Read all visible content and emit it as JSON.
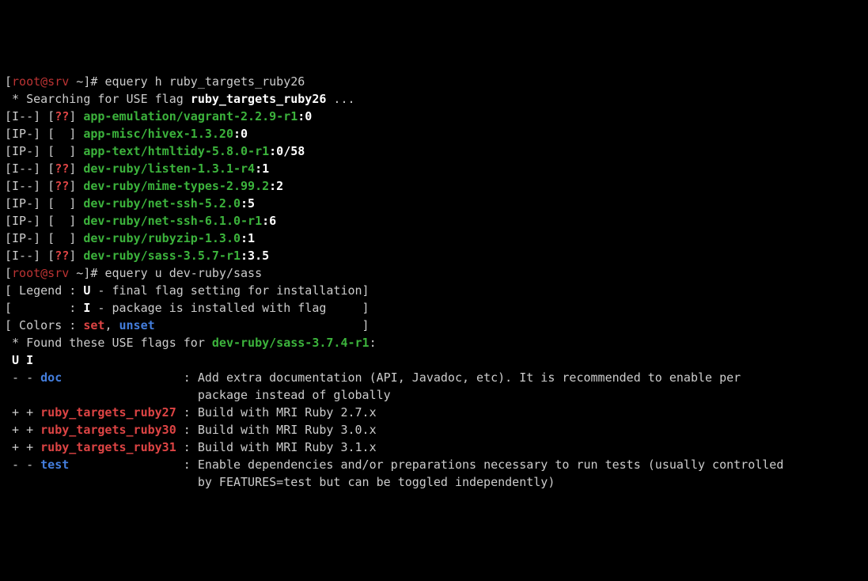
{
  "prompt1_user": "root@srv",
  "prompt1_path": "~",
  "cmd1": "equery h ruby_targets_ruby26",
  "searching_prefix": " * Searching for USE flag ",
  "searching_flag": "ruby_targets_ruby26",
  "searching_suffix": " ...",
  "results": [
    {
      "inst": "I--",
      "mask_open": "[",
      "mask": "??",
      "mask_close": "]",
      "pkg": "app-emulation/vagrant-2.2.9-r1",
      "slot": ":0"
    },
    {
      "inst": "IP-",
      "mask_open": "[",
      "mask": "  ",
      "mask_close": "]",
      "pkg": "app-misc/hivex-1.3.20",
      "slot": ":0"
    },
    {
      "inst": "IP-",
      "mask_open": "[",
      "mask": "  ",
      "mask_close": "]",
      "pkg": "app-text/htmltidy-5.8.0-r1",
      "slot": ":0/58"
    },
    {
      "inst": "I--",
      "mask_open": "[",
      "mask": "??",
      "mask_close": "]",
      "pkg": "dev-ruby/listen-1.3.1-r4",
      "slot": ":1"
    },
    {
      "inst": "I--",
      "mask_open": "[",
      "mask": "??",
      "mask_close": "]",
      "pkg": "dev-ruby/mime-types-2.99.2",
      "slot": ":2"
    },
    {
      "inst": "IP-",
      "mask_open": "[",
      "mask": "  ",
      "mask_close": "]",
      "pkg": "dev-ruby/net-ssh-5.2.0",
      "slot": ":5"
    },
    {
      "inst": "IP-",
      "mask_open": "[",
      "mask": "  ",
      "mask_close": "]",
      "pkg": "dev-ruby/net-ssh-6.1.0-r1",
      "slot": ":6"
    },
    {
      "inst": "IP-",
      "mask_open": "[",
      "mask": "  ",
      "mask_close": "]",
      "pkg": "dev-ruby/rubyzip-1.3.0",
      "slot": ":1"
    },
    {
      "inst": "I--",
      "mask_open": "[",
      "mask": "??",
      "mask_close": "]",
      "pkg": "dev-ruby/sass-3.5.7-r1",
      "slot": ":3.5"
    }
  ],
  "cmd2": "equery u dev-ruby/sass",
  "legend1_open": "[ Legend : ",
  "legend1_key": "U",
  "legend1_desc": " - final flag setting for installation]",
  "legend2_open": "[        : ",
  "legend2_key": "I",
  "legend2_desc": " - package is installed with flag     ]",
  "colors_open": "[ Colors : ",
  "colors_set": "set",
  "colors_sep": ", ",
  "colors_unset": "unset",
  "colors_close": "                             ]",
  "found_prefix": " * Found these USE flags for ",
  "found_pkg": "dev-ruby/sass-3.7.4-r1",
  "found_colon": ":",
  "header": " U I",
  "flags": [
    {
      "u": "-",
      "i": "-",
      "name": "doc",
      "pad": "                 ",
      "desc1": ": Add extra documentation (API, Javadoc, etc). It is recommended to enable per",
      "desc2": "                           package instead of globally",
      "color": "blue"
    },
    {
      "u": "+",
      "i": "+",
      "name": "ruby_targets_ruby27",
      "pad": " ",
      "desc1": ": Build with MRI Ruby 2.7.x",
      "desc2": "",
      "color": "red"
    },
    {
      "u": "+",
      "i": "+",
      "name": "ruby_targets_ruby30",
      "pad": " ",
      "desc1": ": Build with MRI Ruby 3.0.x",
      "desc2": "",
      "color": "red"
    },
    {
      "u": "+",
      "i": "+",
      "name": "ruby_targets_ruby31",
      "pad": " ",
      "desc1": ": Build with MRI Ruby 3.1.x",
      "desc2": "",
      "color": "red"
    },
    {
      "u": "-",
      "i": "-",
      "name": "test",
      "pad": "                ",
      "desc1": ": Enable dependencies and/or preparations necessary to run tests (usually controlled",
      "desc2": "                           by FEATURES=test but can be toggled independently)",
      "color": "blue"
    }
  ]
}
